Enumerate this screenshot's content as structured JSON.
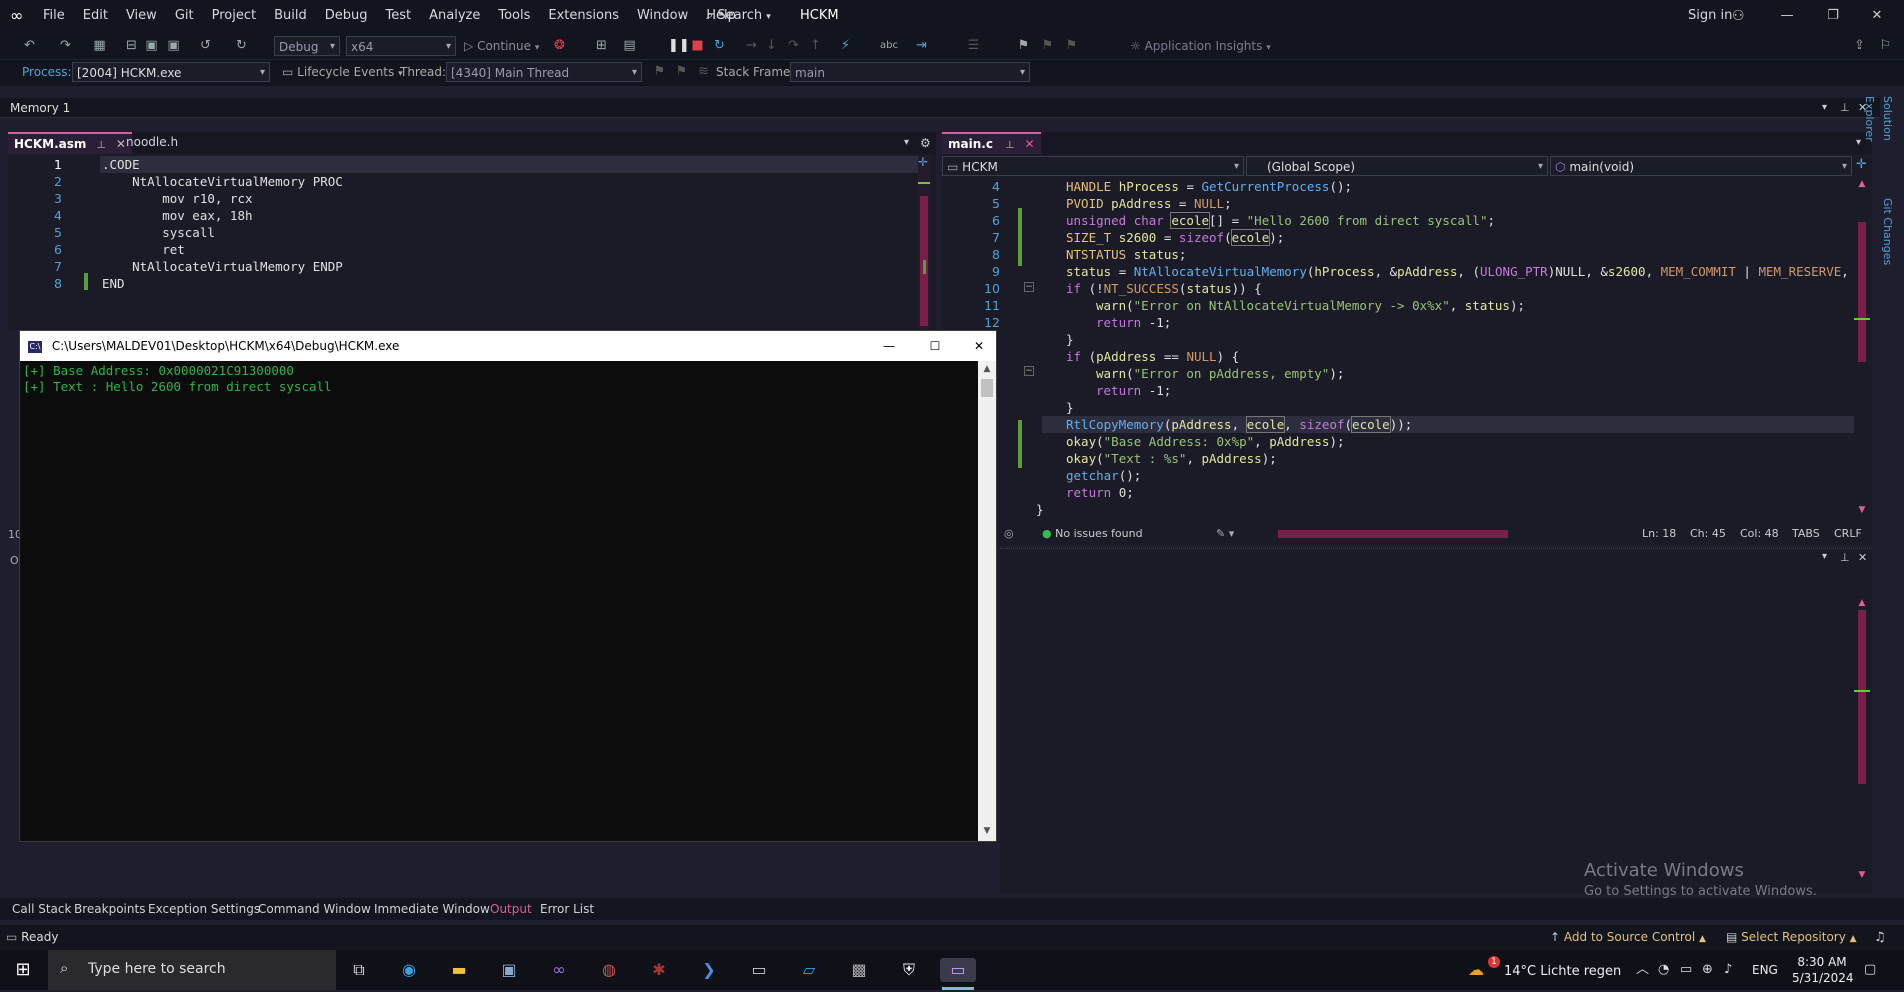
{
  "menu": {
    "items": [
      "File",
      "Edit",
      "View",
      "Git",
      "Project",
      "Build",
      "Debug",
      "Test",
      "Analyze",
      "Tools",
      "Extensions",
      "Window",
      "Help"
    ],
    "search_label": "Search",
    "solution_name": "HCKM",
    "sign_in": "Sign in"
  },
  "toolbar": {
    "config": "Debug",
    "platform": "x64",
    "continue_label": "Continue",
    "app_insights": "Application Insights"
  },
  "debugbar": {
    "process_label": "Process:",
    "process_value": "[2004] HCKM.exe",
    "lifecycle_label": "Lifecycle Events",
    "thread_label": "Thread:",
    "thread_value": "[4340] Main Thread",
    "stackframe_label": "Stack Frame:",
    "stackframe_value": "main"
  },
  "memory_window": {
    "title": "Memory 1"
  },
  "left_editor": {
    "tabs": [
      "HCKM.asm",
      "noodle.h"
    ],
    "line_numbers": [
      "1",
      "2",
      "3",
      "4",
      "5",
      "6",
      "7",
      "8"
    ],
    "lines": [
      ".CODE",
      "    NtAllocateVirtualMemory PROC",
      "        mov r10, rcx",
      "        mov eax, 18h",
      "        syscall",
      "        ret",
      "    NtAllocateVirtualMemory ENDP",
      "END"
    ]
  },
  "right_editor": {
    "tab": "main.c",
    "project_combo": "HCKM",
    "scope_combo": "(Global Scope)",
    "function_combo": "main(void)",
    "line_numbers": [
      "4",
      "5",
      "6",
      "7",
      "8",
      "9",
      "10",
      "11",
      "12"
    ],
    "status_issues": "No issues found",
    "status_ln": "Ln: 18",
    "status_ch": "Ch: 45",
    "status_col": "Col: 48",
    "status_tabs": "TABS",
    "status_crlf": "CRLF"
  },
  "console": {
    "title": "C:\\Users\\MALDEV01\\Desktop\\HCKM\\x64\\Debug\\HCKM.exe",
    "lines": [
      "[+] Base Address: 0x0000021C91300000",
      "[+] Text : Hello 2600 from direct syscall"
    ]
  },
  "bottom_tabs": [
    "Call Stack",
    "Breakpoints",
    "Exception Settings",
    "Command Window",
    "Immediate Window",
    "Output",
    "Error List"
  ],
  "active_bottom_tab": "Output",
  "watermark": {
    "title": "Activate Windows",
    "subtitle": "Go to Settings to activate Windows."
  },
  "status": {
    "ready": "Ready",
    "source_control": "Add to Source Control",
    "repository": "Select Repository"
  },
  "taskbar": {
    "search_placeholder": "Type here to search",
    "weather": "14°C  Lichte regen",
    "language": "ENG",
    "time": "8:30 AM",
    "date": "5/31/2024",
    "notification_badge": "1"
  },
  "side_labels": {
    "solution_explorer": "Solution Explorer",
    "git_changes": "Git Changes"
  },
  "colors": {
    "accent": "#e05b9b",
    "console_text": "#2fb34a",
    "link": "#4ea3d8"
  }
}
